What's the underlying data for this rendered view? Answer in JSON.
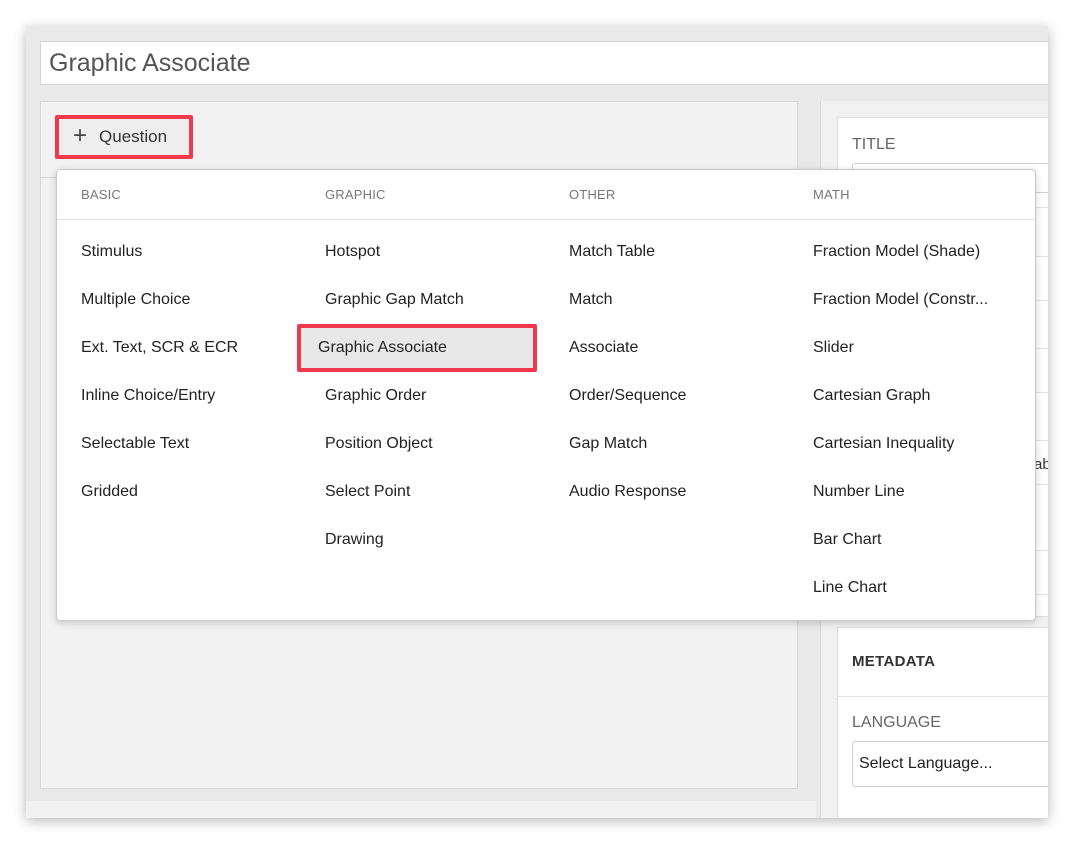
{
  "title": "Graphic Associate",
  "toolbar": {
    "question_button_label": "Question"
  },
  "sidebar": {
    "title_label": "TITLE",
    "partial_text": "ab",
    "metadata_heading": "METADATA",
    "language_label": "LANGUAGE",
    "language_placeholder": "Select Language..."
  },
  "dropdown": {
    "columns": [
      {
        "heading": "BASIC",
        "items": [
          "Stimulus",
          "Multiple Choice",
          "Ext. Text, SCR & ECR",
          "Inline Choice/Entry",
          "Selectable Text",
          "Gridded"
        ]
      },
      {
        "heading": "GRAPHIC",
        "items": [
          "Hotspot",
          "Graphic Gap Match",
          "Graphic Associate",
          "Graphic Order",
          "Position Object",
          "Select Point",
          "Drawing"
        ]
      },
      {
        "heading": "OTHER",
        "items": [
          "Match Table",
          "Match",
          "Associate",
          "Order/Sequence",
          "Gap Match",
          "Audio Response"
        ]
      },
      {
        "heading": "MATH",
        "items": [
          "Fraction Model (Shade)",
          "Fraction Model (Constr...",
          "Slider",
          "Cartesian Graph",
          "Cartesian Inequality",
          "Number Line",
          "Bar Chart",
          "Line Chart"
        ]
      }
    ],
    "selected": "Graphic Associate"
  },
  "colors": {
    "highlight": "#f0394b",
    "selected_bg": "#e8e8e8"
  }
}
